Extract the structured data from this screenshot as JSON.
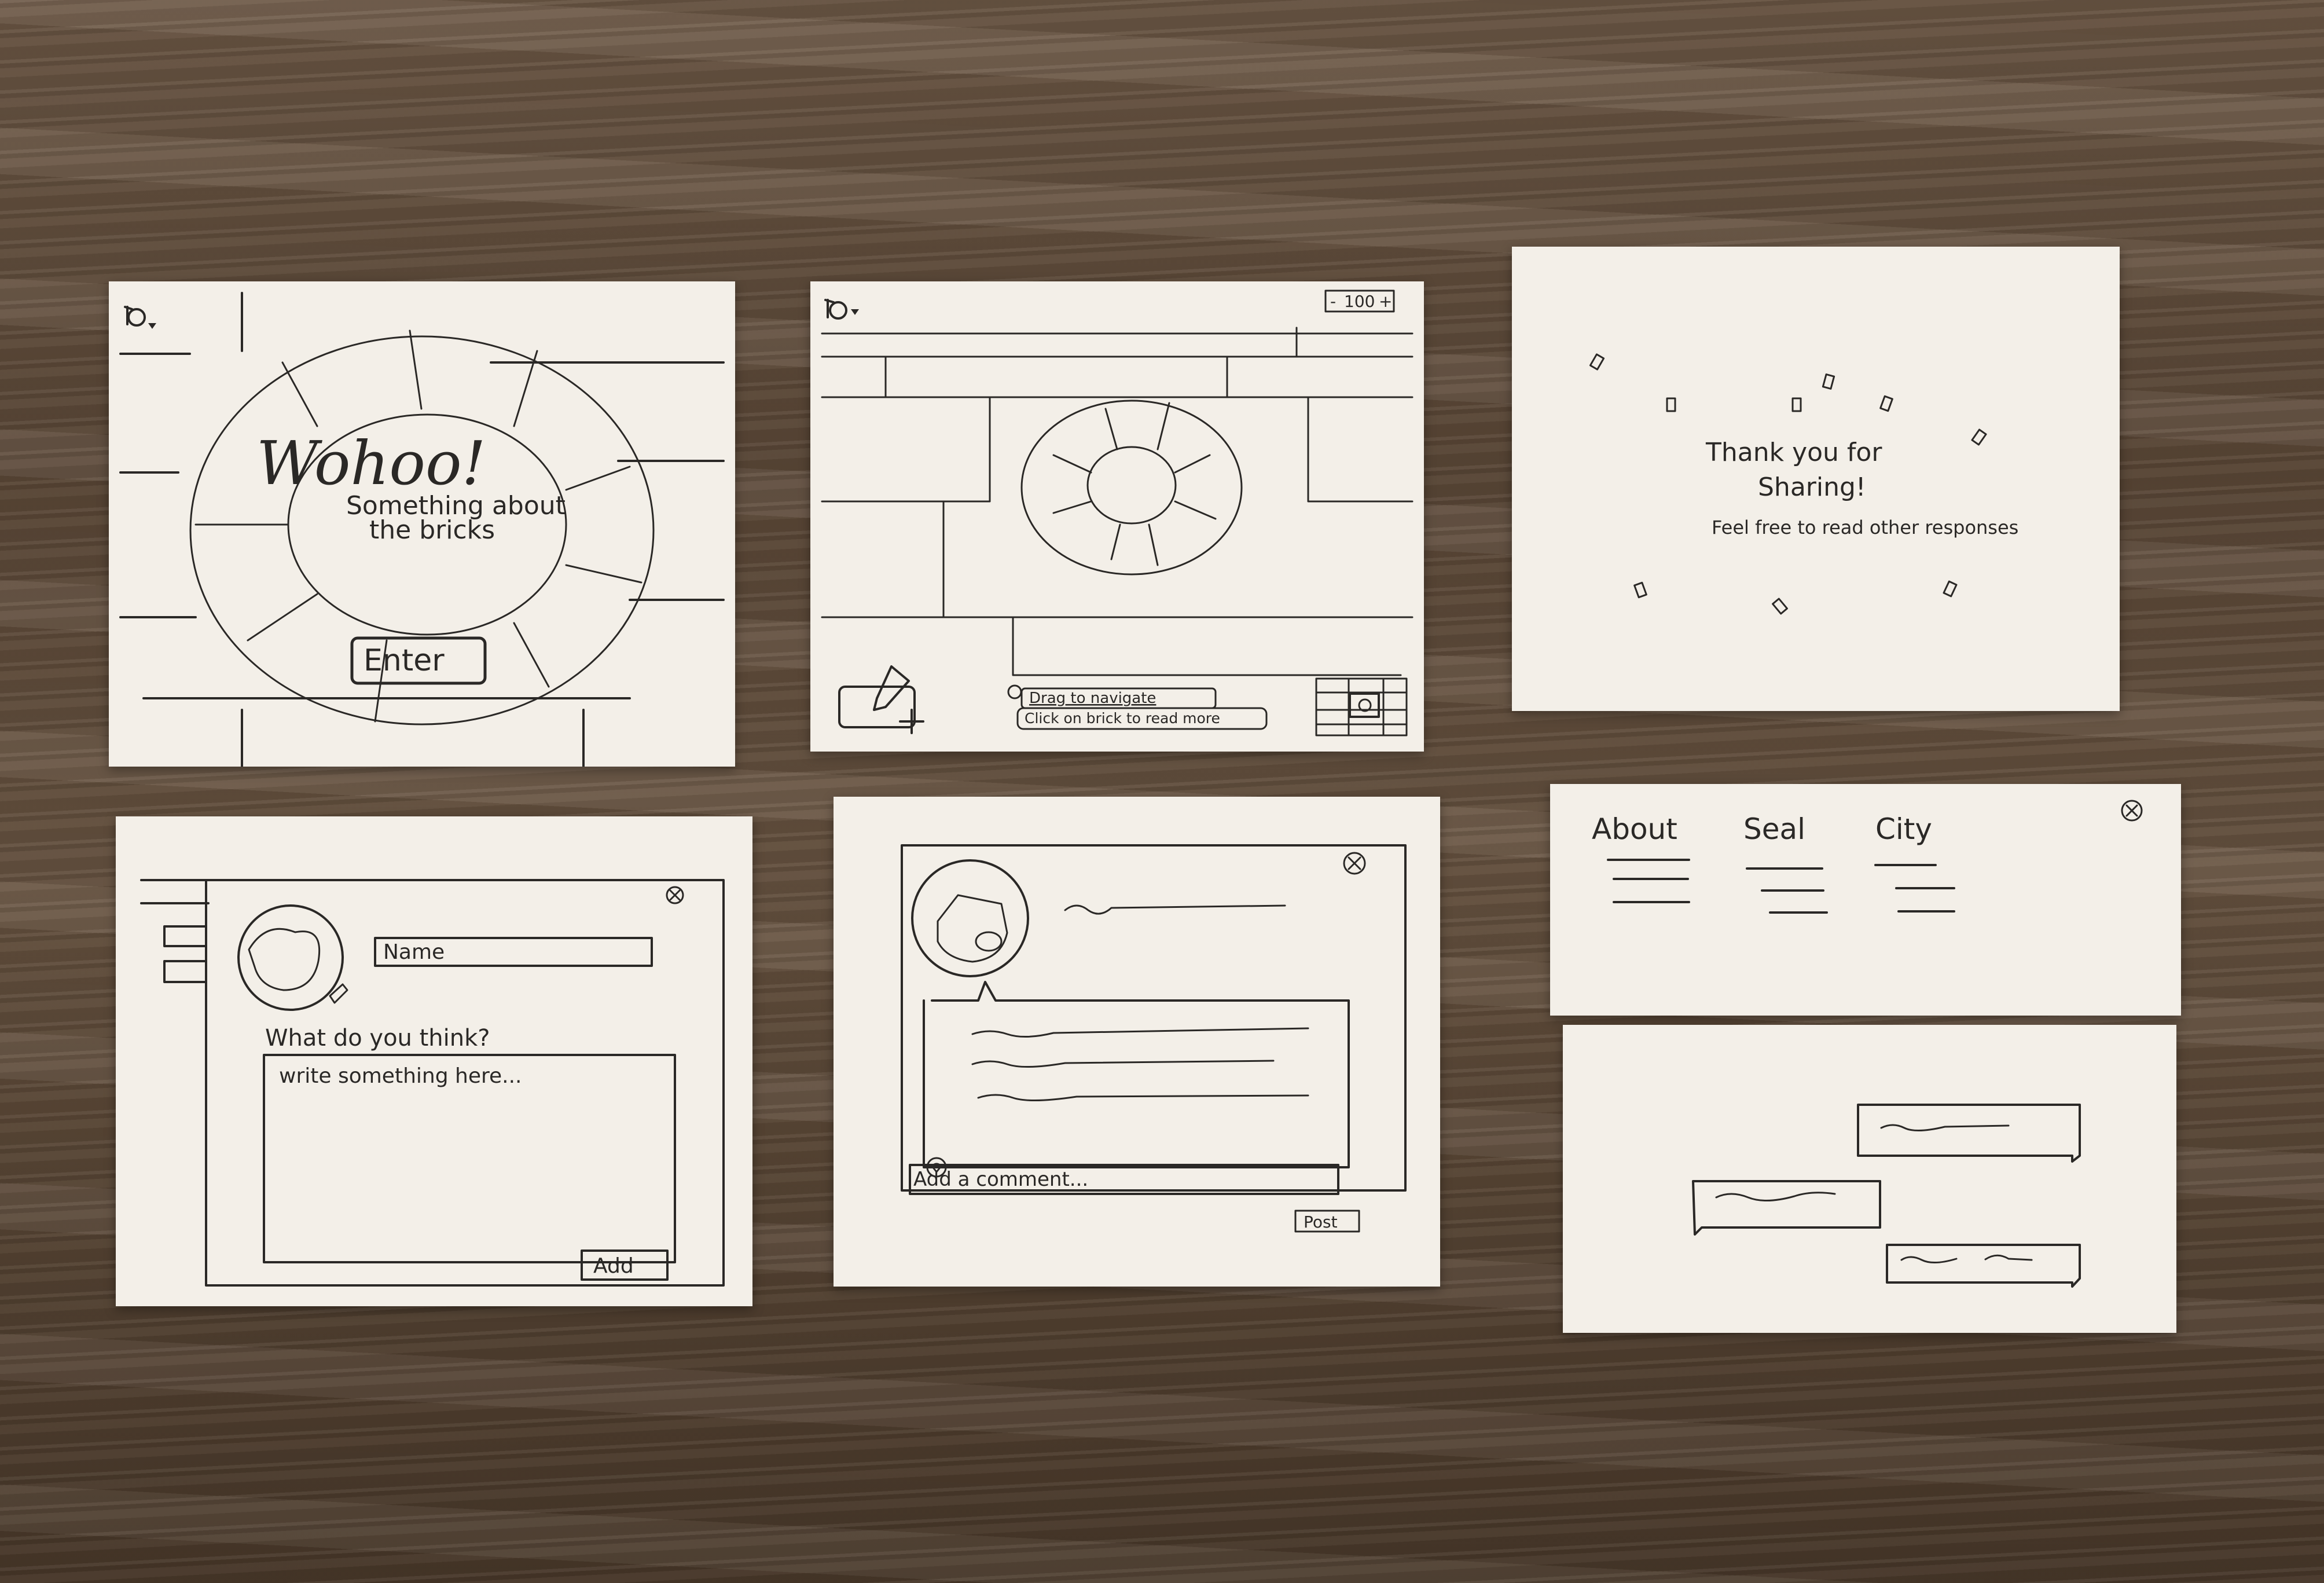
{
  "landing": {
    "title": "Wohoo!",
    "subtitle_line1": "Something about",
    "subtitle_line2": "the bricks",
    "enter_label": "Enter"
  },
  "wall": {
    "zoom_value": "100",
    "zoom_minus": "-",
    "zoom_plus": "+",
    "hint_drag": "Drag to navigate",
    "hint_click": "Click on brick to read more"
  },
  "thanks": {
    "line1": "Thank you for",
    "line2": "Sharing!",
    "line3": "Feel free to read other responses"
  },
  "add_form": {
    "name_placeholder": "Name",
    "question": "What do you think?",
    "textarea_placeholder": "write something here...",
    "add_label": "Add"
  },
  "response": {
    "comment_placeholder": "Add a comment...",
    "post_label": "Post"
  },
  "about_tabs": {
    "tabs": [
      "About",
      "Seal",
      "City"
    ]
  }
}
